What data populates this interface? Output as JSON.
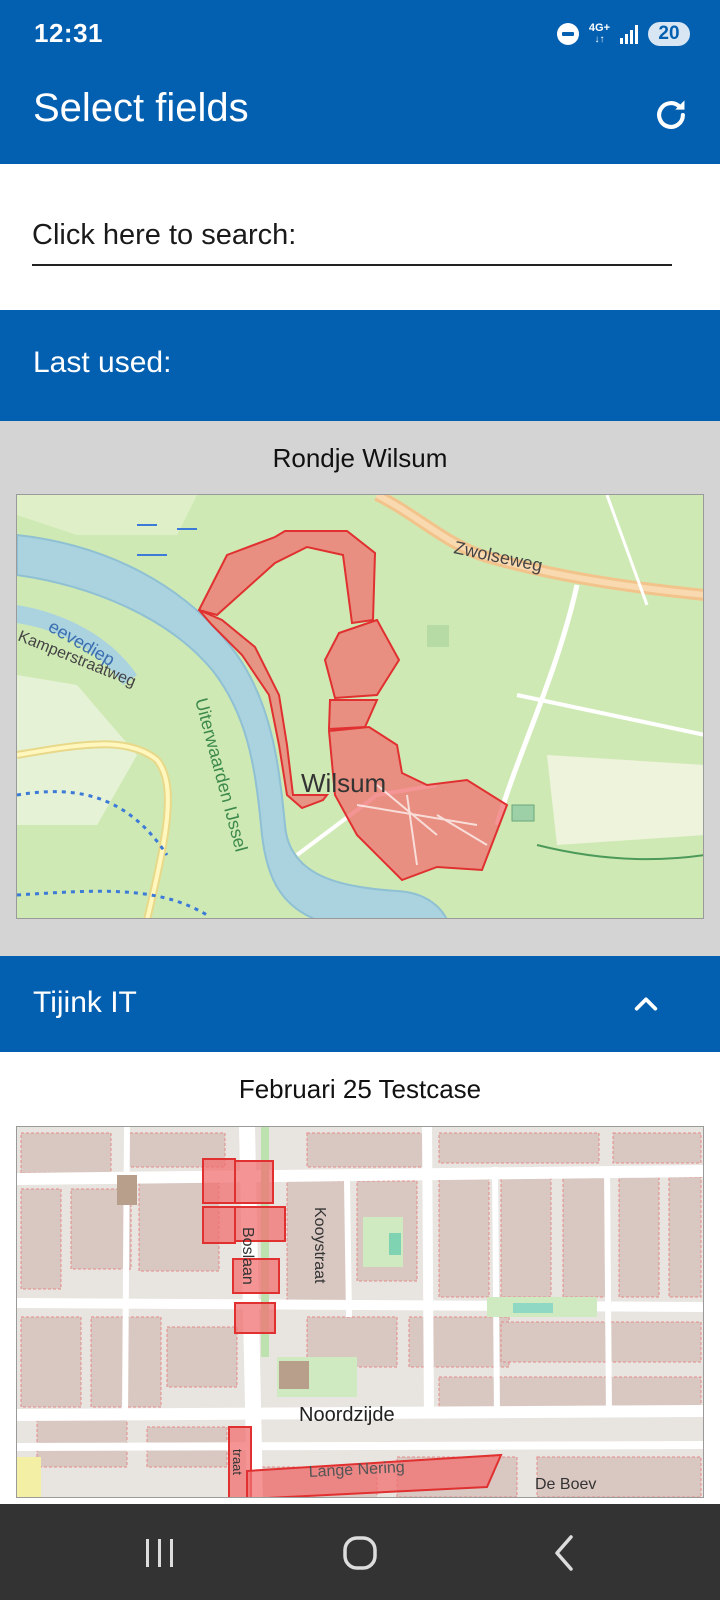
{
  "status_bar": {
    "time": "12:31",
    "network": "4G+",
    "battery": "20"
  },
  "app_bar": {
    "title": "Select fields",
    "refresh_icon": "refresh-icon"
  },
  "search": {
    "placeholder": "Click here to search:"
  },
  "last_used": {
    "header": "Last used:",
    "card": {
      "title": "Rondje Wilsum",
      "map_labels": {
        "town": "Wilsum",
        "road": "Zwolseweg",
        "water": "eevediep",
        "street": "Kamperstraatweg",
        "floodplain": "Uiterwaarden IJssel"
      }
    }
  },
  "groups": [
    {
      "header": "Tijink IT",
      "expanded": true,
      "chevron_icon": "chevron-up-icon",
      "card": {
        "title": "Februari 25 Testcase",
        "map_labels": {
          "street_1": "Noordzijde",
          "street_2": "Lange Nering",
          "street_3": "Boslaan",
          "street_4": "Kooystraat",
          "street_5": "De Boev",
          "street_6": "traat"
        }
      }
    }
  ],
  "nav_bar": {
    "recents_icon": "recents-icon",
    "home_icon": "home-icon",
    "back_icon": "back-icon"
  },
  "colors": {
    "primary": "#0360b0",
    "field_fill": "#f07070",
    "field_stroke": "#e03030",
    "map_green": "#cfe9b4",
    "river": "#aad3df"
  }
}
